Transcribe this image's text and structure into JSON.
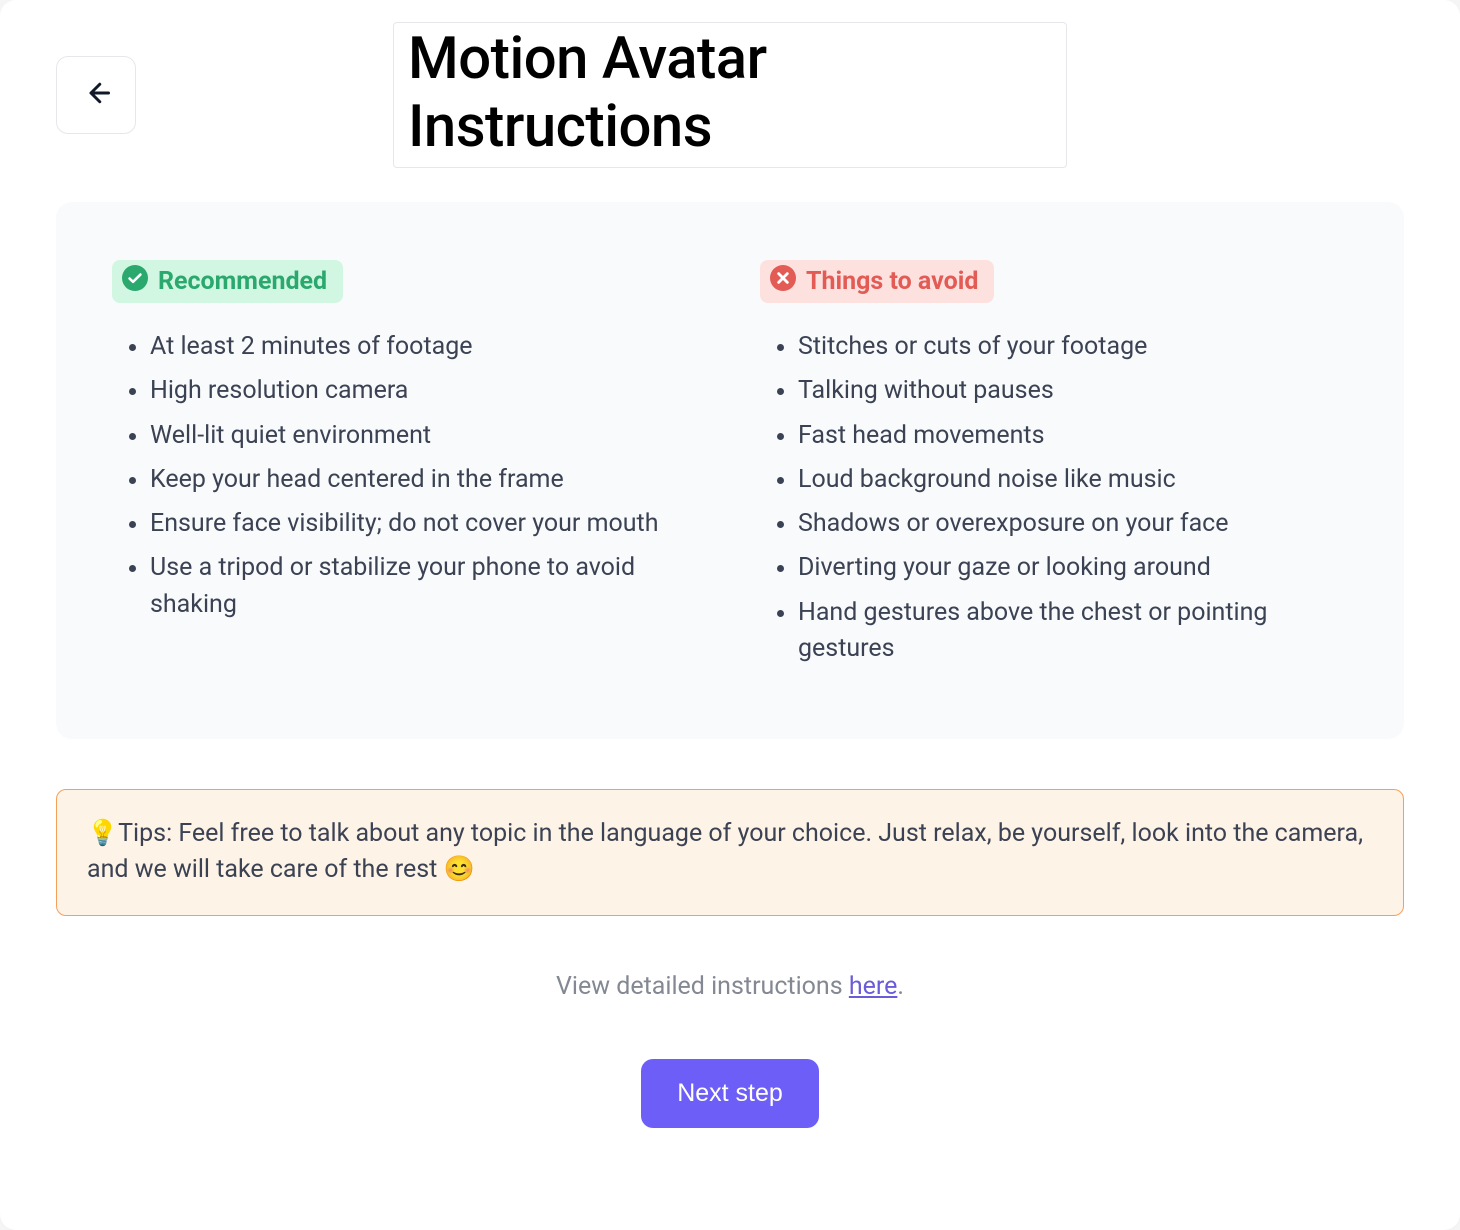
{
  "header": {
    "title": "Motion Avatar Instructions"
  },
  "panel": {
    "recommended": {
      "label": "Recommended",
      "items": [
        "At least 2 minutes of footage",
        "High resolution camera",
        "Well-lit quiet environment",
        "Keep your head centered in the frame",
        "Ensure face visibility; do not cover your mouth",
        "Use a tripod or stabilize your phone to avoid shaking"
      ]
    },
    "avoid": {
      "label": "Things to avoid",
      "items": [
        "Stitches or cuts of your footage",
        "Talking without pauses",
        "Fast head movements",
        "Loud background noise like music",
        "Shadows or overexposure on your face",
        "Diverting your gaze or looking around",
        "Hand gestures above the chest or pointing gestures"
      ]
    }
  },
  "tips": {
    "text": "💡Tips: Feel free to talk about any topic in the language of your choice. Just relax, be yourself, look into the camera, and we will take care of the rest 😊"
  },
  "detailed": {
    "prefix": "View detailed instructions ",
    "link_text": "here",
    "suffix": "."
  },
  "actions": {
    "next_label": "Next step"
  }
}
